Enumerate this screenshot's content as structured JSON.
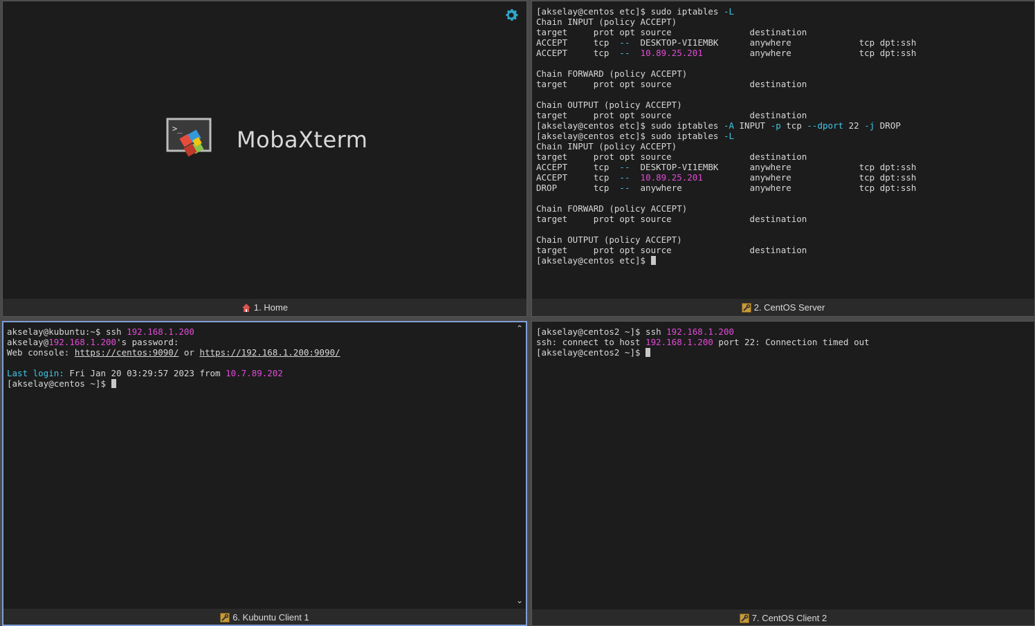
{
  "home": {
    "footer_label": "1. Home",
    "logo_text": "MobaXterm"
  },
  "centos_server": {
    "footer_label": "2. CentOS Server",
    "lines": [
      [
        {
          "t": "[akselay@centos etc]$ sudo iptables "
        },
        {
          "t": "-L",
          "c": "flag"
        }
      ],
      [
        {
          "t": "Chain INPUT (policy ACCEPT)"
        }
      ],
      [
        {
          "t": "target     prot opt source               destination"
        }
      ],
      [
        {
          "t": "ACCEPT     tcp  "
        },
        {
          "t": "--",
          "c": "dash"
        },
        {
          "t": "  DESKTOP-VI1EMBK      anywhere             tcp dpt:ssh"
        }
      ],
      [
        {
          "t": "ACCEPT     tcp  "
        },
        {
          "t": "--",
          "c": "dash"
        },
        {
          "t": "  "
        },
        {
          "t": "10.89.25.201",
          "c": "ip"
        },
        {
          "t": "         anywhere             tcp dpt:ssh"
        }
      ],
      [
        {
          "t": ""
        }
      ],
      [
        {
          "t": "Chain FORWARD (policy ACCEPT)"
        }
      ],
      [
        {
          "t": "target     prot opt source               destination"
        }
      ],
      [
        {
          "t": ""
        }
      ],
      [
        {
          "t": "Chain OUTPUT (policy ACCEPT)"
        }
      ],
      [
        {
          "t": "target     prot opt source               destination"
        }
      ],
      [
        {
          "t": "[akselay@centos etc]$ sudo iptables "
        },
        {
          "t": "-A",
          "c": "flag"
        },
        {
          "t": " INPUT "
        },
        {
          "t": "-p",
          "c": "flag"
        },
        {
          "t": " tcp "
        },
        {
          "t": "--dport",
          "c": "flag"
        },
        {
          "t": " 22 "
        },
        {
          "t": "-j",
          "c": "flag"
        },
        {
          "t": " DROP"
        }
      ],
      [
        {
          "t": "[akselay@centos etc]$ sudo iptables "
        },
        {
          "t": "-L",
          "c": "flag"
        }
      ],
      [
        {
          "t": "Chain INPUT (policy ACCEPT)"
        }
      ],
      [
        {
          "t": "target     prot opt source               destination"
        }
      ],
      [
        {
          "t": "ACCEPT     tcp  "
        },
        {
          "t": "--",
          "c": "dash"
        },
        {
          "t": "  DESKTOP-VI1EMBK      anywhere             tcp dpt:ssh"
        }
      ],
      [
        {
          "t": "ACCEPT     tcp  "
        },
        {
          "t": "--",
          "c": "dash"
        },
        {
          "t": "  "
        },
        {
          "t": "10.89.25.201",
          "c": "ip"
        },
        {
          "t": "         anywhere             tcp dpt:ssh"
        }
      ],
      [
        {
          "t": "DROP       tcp  "
        },
        {
          "t": "--",
          "c": "dash"
        },
        {
          "t": "  anywhere             anywhere             tcp dpt:ssh"
        }
      ],
      [
        {
          "t": ""
        }
      ],
      [
        {
          "t": "Chain FORWARD (policy ACCEPT)"
        }
      ],
      [
        {
          "t": "target     prot opt source               destination"
        }
      ],
      [
        {
          "t": ""
        }
      ],
      [
        {
          "t": "Chain OUTPUT (policy ACCEPT)"
        }
      ],
      [
        {
          "t": "target     prot opt source               destination"
        }
      ],
      [
        {
          "t": "[akselay@centos etc]$ "
        },
        {
          "t": "",
          "c": "cursor"
        }
      ]
    ]
  },
  "kubuntu_client": {
    "footer_label": "6. Kubuntu Client 1",
    "lines": [
      [
        {
          "t": "akselay@kubuntu:~$ ssh "
        },
        {
          "t": "192.168.1.200",
          "c": "ip"
        }
      ],
      [
        {
          "t": "akselay@"
        },
        {
          "t": "192.168.1.200",
          "c": "ip"
        },
        {
          "t": "'s password:"
        }
      ],
      [
        {
          "t": "Web console: "
        },
        {
          "t": "https://centos:9090/",
          "c": "u"
        },
        {
          "t": " or "
        },
        {
          "t": "https://192.168.1.200:9090/",
          "c": "u"
        }
      ],
      [
        {
          "t": ""
        }
      ],
      [
        {
          "t": "Last login:",
          "c": "cyan"
        },
        {
          "t": " Fri Jan 20 03:29:57 2023 from "
        },
        {
          "t": "10.7.89.202",
          "c": "ip"
        }
      ],
      [
        {
          "t": "[akselay@centos ~]$ "
        },
        {
          "t": "",
          "c": "cursor"
        }
      ]
    ]
  },
  "centos_client2": {
    "footer_label": "7. CentOS Client 2",
    "lines": [
      [
        {
          "t": "[akselay@centos2 ~]$ ssh "
        },
        {
          "t": "192.168.1.200",
          "c": "ip"
        }
      ],
      [
        {
          "t": "ssh: connect to host "
        },
        {
          "t": "192.168.1.200",
          "c": "ip"
        },
        {
          "t": " port 22: Connection timed out"
        }
      ],
      [
        {
          "t": "[akselay@centos2 ~]$ "
        },
        {
          "t": "",
          "c": "cursor"
        }
      ]
    ]
  },
  "icons": {
    "settings": "gear-icon",
    "home": "house-icon",
    "session": "wrench-icon",
    "scroll_up": "chevron-up-icon",
    "scroll_down": "chevron-down-icon"
  },
  "colors": {
    "ip": "#e24bd8",
    "flag": "#3ec7e6",
    "active_border": "#7f9fd8",
    "gear": "#2fa6c9"
  }
}
